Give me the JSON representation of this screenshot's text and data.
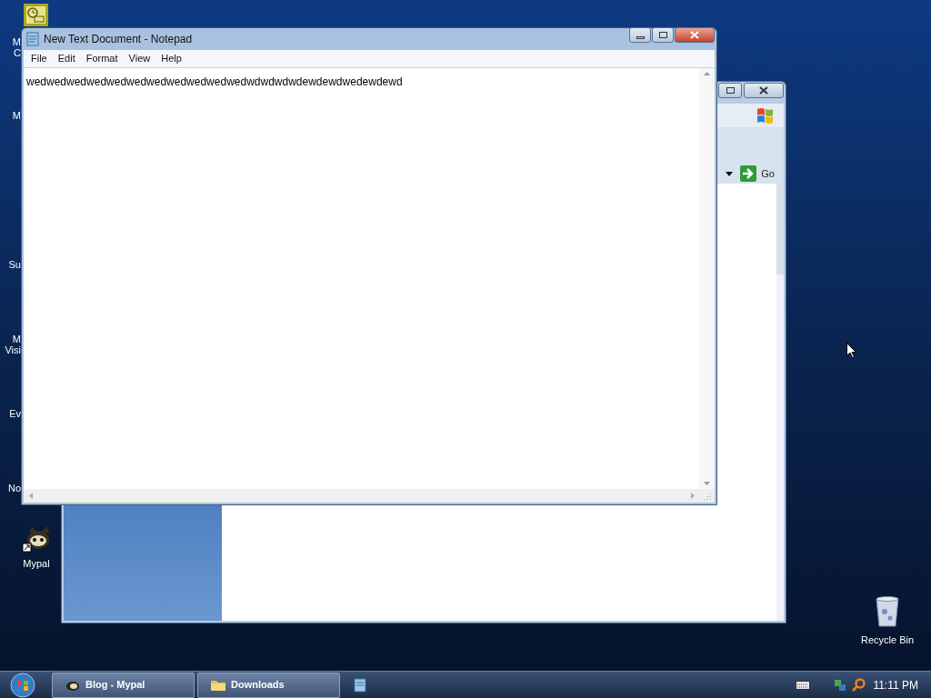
{
  "desktop_icons": [
    {
      "lines": [
        "M",
        "C"
      ]
    },
    {
      "lines": [
        "M"
      ]
    },
    {
      "lines": [
        "Su"
      ]
    },
    {
      "lines": [
        "M",
        "Visi"
      ]
    },
    {
      "lines": [
        "Ev"
      ]
    },
    {
      "lines": [
        "No"
      ]
    }
  ],
  "mypal_icon": {
    "label": "Mypal"
  },
  "recycle_bin": {
    "label": "Recycle Bin"
  },
  "browser_window": {
    "go_button": "Go"
  },
  "notepad": {
    "title": "New Text Document - Notepad",
    "menu": [
      "File",
      "Edit",
      "Format",
      "View",
      "Help"
    ],
    "text": "wedwedwedwedwedwedwedwedwedwedwedwdwdwdwdewdewdwedewdewd"
  },
  "taskbar": {
    "buttons": [
      {
        "label": "Blog - Mypal",
        "kind": "browser"
      },
      {
        "label": "Downloads",
        "kind": "folder"
      }
    ],
    "clock": "11:11 PM"
  }
}
